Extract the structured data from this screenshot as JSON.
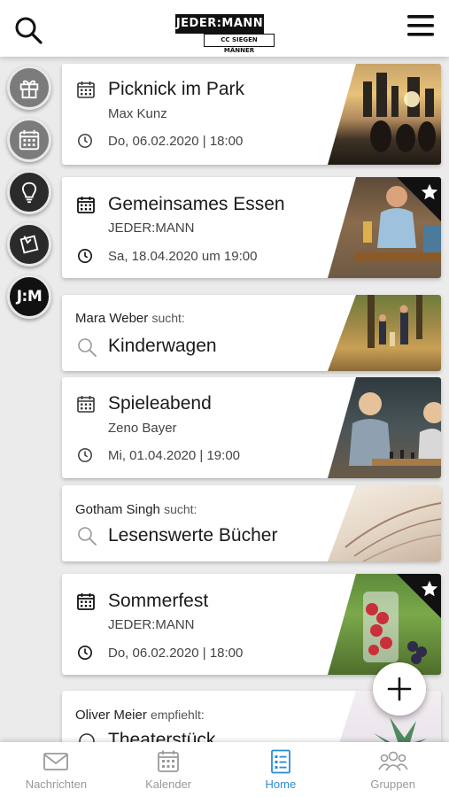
{
  "header": {
    "logo_top": "JEDER:MANN",
    "logo_bottom": "CC SIEGEN MÄNNER"
  },
  "sidebar": {
    "items": [
      {
        "icon": "gift-icon"
      },
      {
        "icon": "calendar-icon"
      },
      {
        "icon": "lightbulb-icon"
      },
      {
        "icon": "sticky-note-icon"
      },
      {
        "label": "J:M"
      }
    ]
  },
  "feed": {
    "cards": [
      {
        "type": "event",
        "title": "Picknick im Park",
        "organizer": "Max Kunz",
        "date": "Do, 06.02.2020 | 18:00",
        "starred": false
      },
      {
        "type": "event",
        "title": "Gemeinsames Essen",
        "organizer": "JEDER:MANN",
        "date": "Sa, 18.04.2020 um 19:00",
        "starred": true
      },
      {
        "type": "search",
        "person": "Mara Weber",
        "verb": "sucht:",
        "title": "Kinderwagen"
      },
      {
        "type": "event",
        "title": "Spieleabend",
        "organizer": "Zeno Bayer",
        "date": "Mi, 01.04.2020 | 19:00",
        "starred": false
      },
      {
        "type": "search",
        "person": "Gotham Singh",
        "verb": "sucht:",
        "title": "Lesenswerte Bücher"
      },
      {
        "type": "event",
        "title": "Sommerfest",
        "organizer": "JEDER:MANN",
        "date": "Do, 06.02.2020 | 18:00",
        "starred": true
      },
      {
        "type": "recommend",
        "person": "Oliver Meier",
        "verb": "empfiehlt:",
        "title": "Theaterstück"
      }
    ]
  },
  "bottom_nav": {
    "items": [
      {
        "label": "Nachrichten",
        "icon": "mail-icon",
        "active": false
      },
      {
        "label": "Kalender",
        "icon": "calendar-icon",
        "active": false
      },
      {
        "label": "Home",
        "icon": "list-icon",
        "active": true
      },
      {
        "label": "Gruppen",
        "icon": "group-icon",
        "active": false
      }
    ]
  },
  "colors": {
    "accent": "#2a8bd6",
    "sidebar_button": "#7b7b7b",
    "sidebar_dark": "#2a2a2a"
  }
}
